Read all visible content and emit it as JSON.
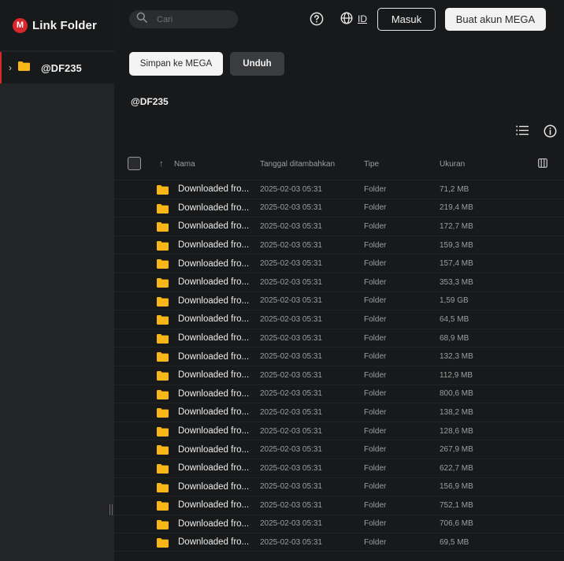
{
  "sidebar": {
    "brand_title": "Link Folder",
    "brand_logo_letter": "M",
    "tree": [
      {
        "label": "@DF235",
        "expanded": false
      }
    ]
  },
  "header": {
    "search_placeholder": "Cari",
    "language": "ID",
    "login_label": "Masuk",
    "create_account_label": "Buat akun MEGA"
  },
  "actions": {
    "save_label": "Simpan ke MEGA",
    "download_label": "Unduh"
  },
  "folder": {
    "title": "@DF235"
  },
  "table": {
    "columns": {
      "name": "Nama",
      "date": "Tanggal ditambahkan",
      "type": "Tipe",
      "size": "Ukuran"
    },
    "rows": [
      {
        "name": "Downloaded fro...",
        "date": "2025-02-03 05:31",
        "type": "Folder",
        "size": "71,2 MB"
      },
      {
        "name": "Downloaded fro...",
        "date": "2025-02-03 05:31",
        "type": "Folder",
        "size": "219,4 MB"
      },
      {
        "name": "Downloaded fro...",
        "date": "2025-02-03 05:31",
        "type": "Folder",
        "size": "172,7 MB"
      },
      {
        "name": "Downloaded fro...",
        "date": "2025-02-03 05:31",
        "type": "Folder",
        "size": "159,3 MB"
      },
      {
        "name": "Downloaded fro...",
        "date": "2025-02-03 05:31",
        "type": "Folder",
        "size": "157,4 MB"
      },
      {
        "name": "Downloaded fro...",
        "date": "2025-02-03 05:31",
        "type": "Folder",
        "size": "353,3 MB"
      },
      {
        "name": "Downloaded fro...",
        "date": "2025-02-03 05:31",
        "type": "Folder",
        "size": "1,59 GB"
      },
      {
        "name": "Downloaded fro...",
        "date": "2025-02-03 05:31",
        "type": "Folder",
        "size": "64,5 MB"
      },
      {
        "name": "Downloaded fro...",
        "date": "2025-02-03 05:31",
        "type": "Folder",
        "size": "68,9 MB"
      },
      {
        "name": "Downloaded fro...",
        "date": "2025-02-03 05:31",
        "type": "Folder",
        "size": "132,3 MB"
      },
      {
        "name": "Downloaded fro...",
        "date": "2025-02-03 05:31",
        "type": "Folder",
        "size": "112,9 MB"
      },
      {
        "name": "Downloaded fro...",
        "date": "2025-02-03 05:31",
        "type": "Folder",
        "size": "800,6 MB"
      },
      {
        "name": "Downloaded fro...",
        "date": "2025-02-03 05:31",
        "type": "Folder",
        "size": "138,2 MB"
      },
      {
        "name": "Downloaded fro...",
        "date": "2025-02-03 05:31",
        "type": "Folder",
        "size": "128,6 MB"
      },
      {
        "name": "Downloaded fro...",
        "date": "2025-02-03 05:31",
        "type": "Folder",
        "size": "267,9 MB"
      },
      {
        "name": "Downloaded fro...",
        "date": "2025-02-03 05:31",
        "type": "Folder",
        "size": "622,7 MB"
      },
      {
        "name": "Downloaded fro...",
        "date": "2025-02-03 05:31",
        "type": "Folder",
        "size": "156,9 MB"
      },
      {
        "name": "Downloaded fro...",
        "date": "2025-02-03 05:31",
        "type": "Folder",
        "size": "752,1 MB"
      },
      {
        "name": "Downloaded fro...",
        "date": "2025-02-03 05:31",
        "type": "Folder",
        "size": "706,6 MB"
      },
      {
        "name": "Downloaded fro...",
        "date": "2025-02-03 05:31",
        "type": "Folder",
        "size": "69,5 MB"
      }
    ]
  },
  "colors": {
    "brand_red": "#d9272e",
    "folder_yellow": "#f9b618",
    "background": "#18191a",
    "sidebar": "#232425"
  },
  "icons": [
    "search-icon",
    "help-icon",
    "globe-icon",
    "list-view-icon",
    "info-icon",
    "columns-icon",
    "folder-icon",
    "chevron-right-icon",
    "sort-arrow-icon"
  ]
}
